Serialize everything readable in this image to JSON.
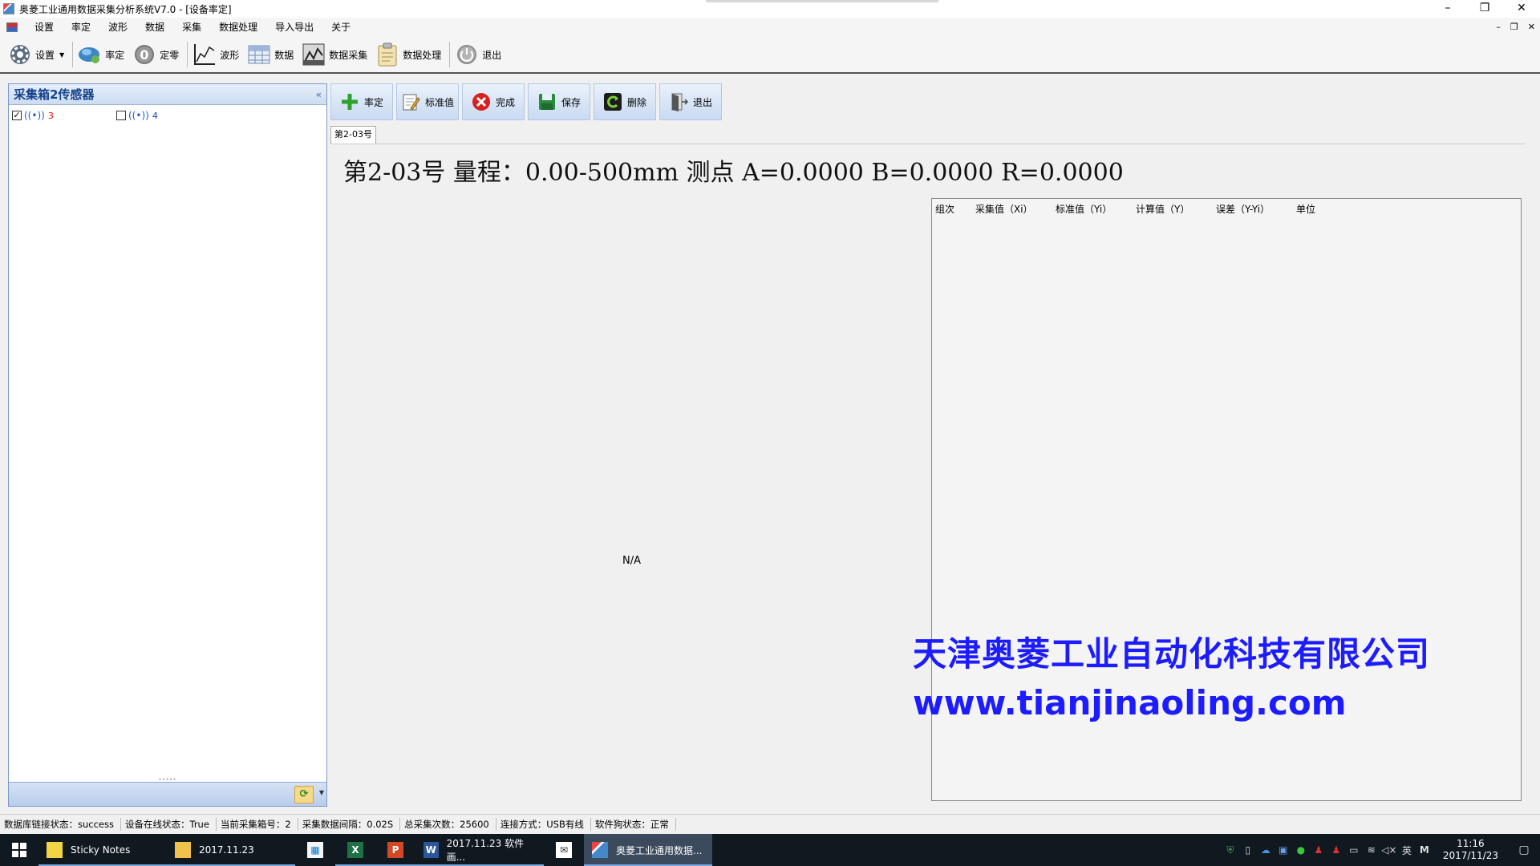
{
  "window": {
    "title": "奥菱工业通用数据采集分析系统V7.0 - [设备率定]"
  },
  "menu": [
    "设置",
    "率定",
    "波形",
    "数据",
    "采集",
    "数据处理",
    "导入导出",
    "关于"
  ],
  "toolbar": [
    {
      "label": "设置",
      "icon": "gear-icon"
    },
    {
      "label": "率定",
      "icon": "calibrate-icon"
    },
    {
      "label": "定零",
      "icon": "zero-icon"
    },
    {
      "label": "波形",
      "icon": "waveform-icon"
    },
    {
      "label": "数据",
      "icon": "grid-icon"
    },
    {
      "label": "数据采集",
      "icon": "acquire-icon"
    },
    {
      "label": "数据处理",
      "icon": "clipboard-icon"
    },
    {
      "label": "退出",
      "icon": "power-icon"
    }
  ],
  "left_panel": {
    "title": "采集箱2传感器",
    "collapse": "«",
    "sensors": [
      {
        "number": "3",
        "checked": true
      },
      {
        "number": "4",
        "checked": false
      }
    ]
  },
  "actions": [
    {
      "label": "率定",
      "icon": "plus-icon"
    },
    {
      "label": "标准值",
      "icon": "edit-icon"
    },
    {
      "label": "完成",
      "icon": "close-circle-icon"
    },
    {
      "label": "保存",
      "icon": "save-icon"
    },
    {
      "label": "删除",
      "icon": "refresh-delete-icon"
    },
    {
      "label": "退出",
      "icon": "exit-door-icon"
    }
  ],
  "tab": {
    "label": "第2-03号"
  },
  "headline": "第2-03号 量程：0.00-500mm 测点 A=0.0000 B=0.0000 R=0.0000",
  "chart": {
    "placeholder": "N/A"
  },
  "table": {
    "columns": [
      "组次",
      "采集值（Xi）",
      "标准值（Yi）",
      "计算值（Y）",
      "误差（Y-Yi）",
      "单位"
    ]
  },
  "watermark": {
    "company": "天津奥菱工业自动化科技有限公司",
    "url": "www.tianjinaoling.com",
    "color": "#1c1cff"
  },
  "status": [
    "数据库链接状态：success",
    "设备在线状态：True",
    "当前采集箱号：2",
    "采集数据间隔：0.02S",
    "总采集次数：25600",
    "连接方式：USB有线",
    "软件狗状态：正常"
  ],
  "taskbar": {
    "items": [
      {
        "label": "Sticky Notes",
        "icon": "sticky-notes-icon"
      },
      {
        "label": "2017.11.23",
        "icon": "folder-icon"
      },
      {
        "label": "",
        "icon": "store-icon"
      },
      {
        "label": "",
        "icon": "excel-icon"
      },
      {
        "label": "",
        "icon": "powerpoint-icon"
      },
      {
        "label": "2017.11.23 软件画...",
        "icon": "word-icon"
      },
      {
        "label": "",
        "icon": "mail-icon"
      },
      {
        "label": "奥菱工业通用数据...",
        "icon": "app-icon"
      }
    ],
    "ime": "英",
    "time": "11:16",
    "date": "2017/11/23"
  }
}
